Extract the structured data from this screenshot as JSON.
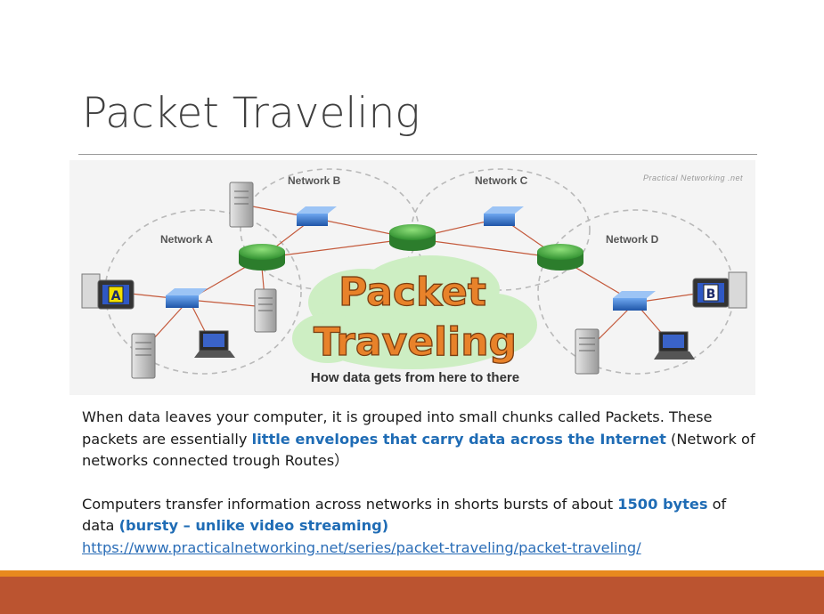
{
  "slide": {
    "title": "Packet Traveling",
    "paragraph1": {
      "text_a": "When data leaves your computer, it is grouped into small chunks called Packets. These packets are essentially ",
      "highlight": "little envelopes that carry data across the Internet",
      "text_b": " (Network of networks connected trough Routes）"
    },
    "paragraph2": {
      "text_a": "Computers transfer information across networks in shorts bursts of about ",
      "highlight_bytes": "1500 bytes",
      "text_b": " of data ",
      "highlight_bursty": "(bursty – unlike video streaming)",
      "link": "https://www.practicalnetworking.net/series/packet-traveling/packet-traveling/"
    }
  },
  "figure": {
    "watermark": "Practical Networking .net",
    "networks": [
      "Network A",
      "Network B",
      "Network C",
      "Network D"
    ],
    "host_a_label": "A",
    "host_b_label": "B",
    "headline_line1": "Packet",
    "headline_line2": "Traveling",
    "tagline": "How data gets from here to there"
  },
  "colors": {
    "title": "#404040",
    "highlight": "#1f6cb5",
    "band_orange": "#e8891e",
    "band_rust": "#bb5430",
    "router_green": "#3aa63a",
    "switch_blue": "#2f74c8",
    "headline_orange": "#e8822a"
  }
}
